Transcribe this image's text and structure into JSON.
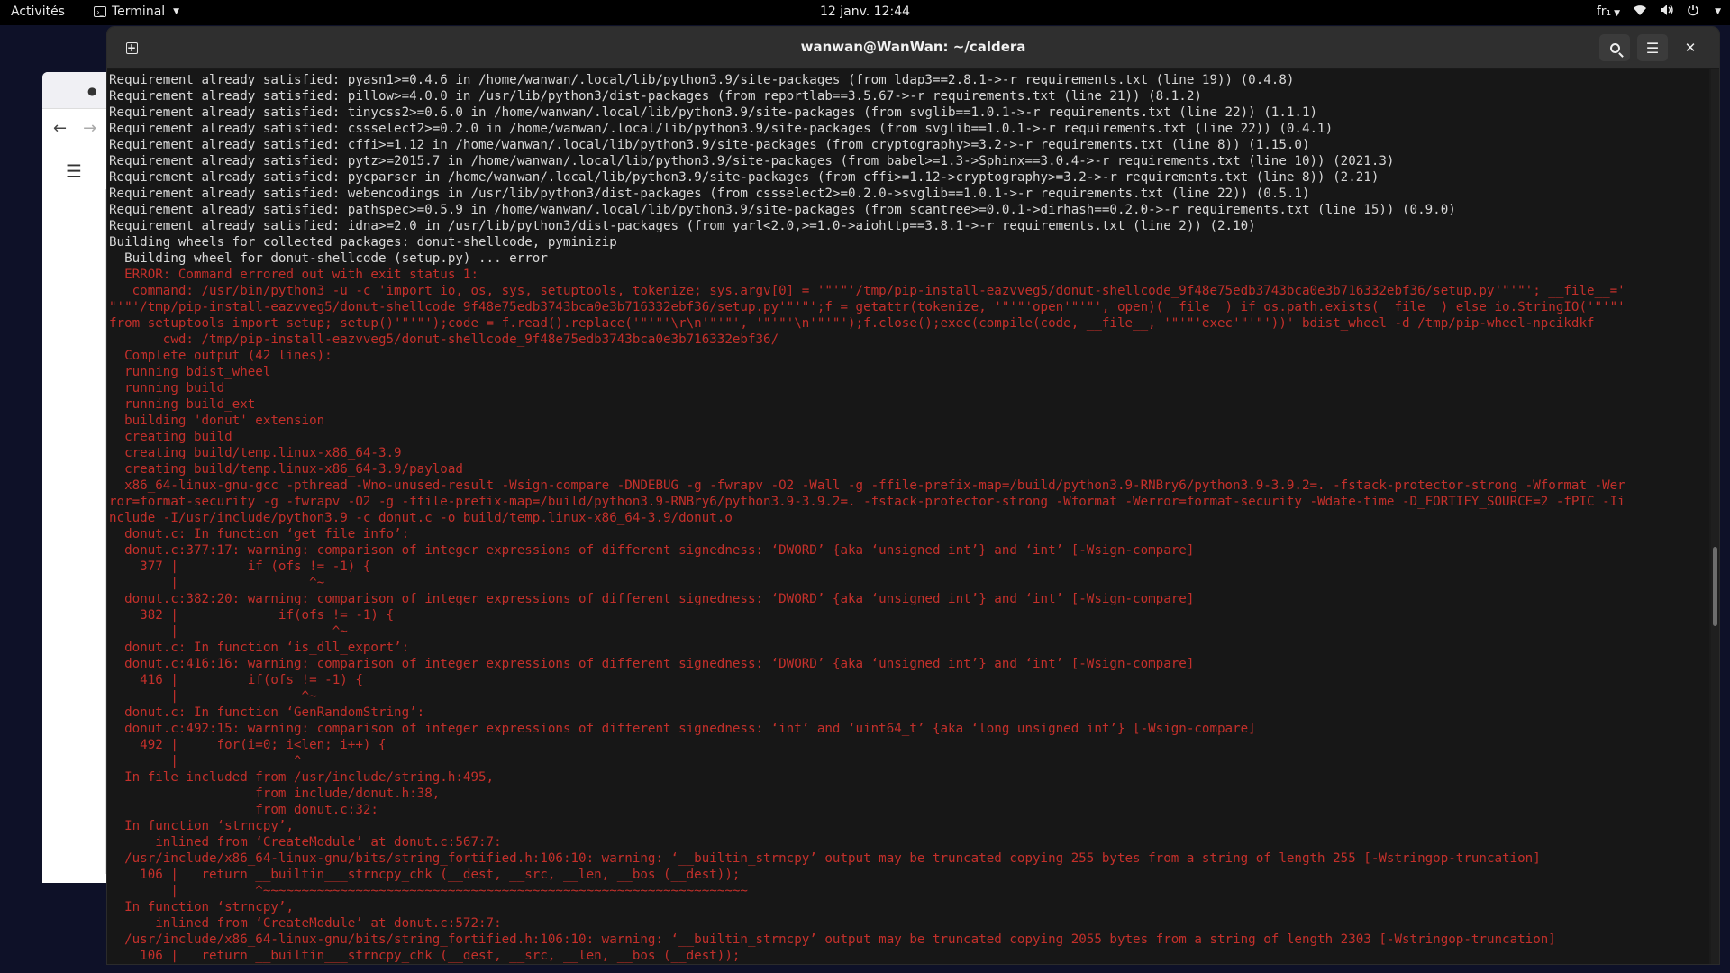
{
  "topbar": {
    "activities": "Activités",
    "app_name": "Terminal",
    "clock": "12 janv.  12:44",
    "keyboard_layout": "fr₁"
  },
  "terminal": {
    "title": "wanwan@WanWan: ~/caldera",
    "lines": [
      {
        "t": "Requirement already satisfied: pyasn1>=0.4.6 in /home/wanwan/.local/lib/python3.9/site-packages (from ldap3==2.8.1->-r requirements.txt (line 19)) (0.4.8)",
        "err": false
      },
      {
        "t": "Requirement already satisfied: pillow>=4.0.0 in /usr/lib/python3/dist-packages (from reportlab==3.5.67->-r requirements.txt (line 21)) (8.1.2)",
        "err": false
      },
      {
        "t": "Requirement already satisfied: tinycss2>=0.6.0 in /home/wanwan/.local/lib/python3.9/site-packages (from svglib==1.0.1->-r requirements.txt (line 22)) (1.1.1)",
        "err": false
      },
      {
        "t": "Requirement already satisfied: cssselect2>=0.2.0 in /home/wanwan/.local/lib/python3.9/site-packages (from svglib==1.0.1->-r requirements.txt (line 22)) (0.4.1)",
        "err": false
      },
      {
        "t": "Requirement already satisfied: cffi>=1.12 in /home/wanwan/.local/lib/python3.9/site-packages (from cryptography>=3.2->-r requirements.txt (line 8)) (1.15.0)",
        "err": false
      },
      {
        "t": "Requirement already satisfied: pytz>=2015.7 in /home/wanwan/.local/lib/python3.9/site-packages (from babel>=1.3->Sphinx==3.0.4->-r requirements.txt (line 10)) (2021.3)",
        "err": false
      },
      {
        "t": "Requirement already satisfied: pycparser in /home/wanwan/.local/lib/python3.9/site-packages (from cffi>=1.12->cryptography>=3.2->-r requirements.txt (line 8)) (2.21)",
        "err": false
      },
      {
        "t": "Requirement already satisfied: webencodings in /usr/lib/python3/dist-packages (from cssselect2>=0.2.0->svglib==1.0.1->-r requirements.txt (line 22)) (0.5.1)",
        "err": false
      },
      {
        "t": "Requirement already satisfied: pathspec>=0.5.9 in /home/wanwan/.local/lib/python3.9/site-packages (from scantree>=0.0.1->dirhash==0.2.0->-r requirements.txt (line 15)) (0.9.0)",
        "err": false
      },
      {
        "t": "Requirement already satisfied: idna>=2.0 in /usr/lib/python3/dist-packages (from yarl<2.0,>=1.0->aiohttp==3.8.1->-r requirements.txt (line 2)) (2.10)",
        "err": false
      },
      {
        "t": "Building wheels for collected packages: donut-shellcode, pyminizip",
        "err": false
      },
      {
        "t": "  Building wheel for donut-shellcode (setup.py) ... error",
        "err": false
      },
      {
        "t": "  ERROR: Command errored out with exit status 1:",
        "err": true
      },
      {
        "t": "   command: /usr/bin/python3 -u -c 'import io, os, sys, setuptools, tokenize; sys.argv[0] = '\"'\"'/tmp/pip-install-eazvveg5/donut-shellcode_9f48e75edb3743bca0e3b716332ebf36/setup.py'\"'\"'; __file__='",
        "err": true
      },
      {
        "t": "\"'\"'/tmp/pip-install-eazvveg5/donut-shellcode_9f48e75edb3743bca0e3b716332ebf36/setup.py'\"'\"';f = getattr(tokenize, '\"'\"'open'\"'\"', open)(__file__) if os.path.exists(__file__) else io.StringIO('\"'\"'",
        "err": true
      },
      {
        "t": "from setuptools import setup; setup()'\"'\"');code = f.read().replace('\"'\"'\\r\\n'\"'\"', '\"'\"'\\n'\"'\"');f.close();exec(compile(code, __file__, '\"'\"'exec'\"'\"'))' bdist_wheel -d /tmp/pip-wheel-npcikdkf",
        "err": true
      },
      {
        "t": "       cwd: /tmp/pip-install-eazvveg5/donut-shellcode_9f48e75edb3743bca0e3b716332ebf36/",
        "err": true
      },
      {
        "t": "  Complete output (42 lines):",
        "err": true
      },
      {
        "t": "  running bdist_wheel",
        "err": true
      },
      {
        "t": "  running build",
        "err": true
      },
      {
        "t": "  running build_ext",
        "err": true
      },
      {
        "t": "  building 'donut' extension",
        "err": true
      },
      {
        "t": "  creating build",
        "err": true
      },
      {
        "t": "  creating build/temp.linux-x86_64-3.9",
        "err": true
      },
      {
        "t": "  creating build/temp.linux-x86_64-3.9/payload",
        "err": true
      },
      {
        "t": "  x86_64-linux-gnu-gcc -pthread -Wno-unused-result -Wsign-compare -DNDEBUG -g -fwrapv -O2 -Wall -g -ffile-prefix-map=/build/python3.9-RNBry6/python3.9-3.9.2=. -fstack-protector-strong -Wformat -Wer",
        "err": true
      },
      {
        "t": "ror=format-security -g -fwrapv -O2 -g -ffile-prefix-map=/build/python3.9-RNBry6/python3.9-3.9.2=. -fstack-protector-strong -Wformat -Werror=format-security -Wdate-time -D_FORTIFY_SOURCE=2 -fPIC -Ii",
        "err": true
      },
      {
        "t": "nclude -I/usr/include/python3.9 -c donut.c -o build/temp.linux-x86_64-3.9/donut.o",
        "err": true
      },
      {
        "t": "  donut.c: In function ‘get_file_info’:",
        "err": true
      },
      {
        "t": "  donut.c:377:17: warning: comparison of integer expressions of different signedness: ‘DWORD’ {aka ‘unsigned int’} and ‘int’ [-Wsign-compare]",
        "err": true
      },
      {
        "t": "    377 |         if (ofs != -1) {",
        "err": true
      },
      {
        "t": "        |                 ^~",
        "err": true
      },
      {
        "t": "  donut.c:382:20: warning: comparison of integer expressions of different signedness: ‘DWORD’ {aka ‘unsigned int’} and ‘int’ [-Wsign-compare]",
        "err": true
      },
      {
        "t": "    382 |             if(ofs != -1) {",
        "err": true
      },
      {
        "t": "        |                    ^~",
        "err": true
      },
      {
        "t": "  donut.c: In function ‘is_dll_export’:",
        "err": true
      },
      {
        "t": "  donut.c:416:16: warning: comparison of integer expressions of different signedness: ‘DWORD’ {aka ‘unsigned int’} and ‘int’ [-Wsign-compare]",
        "err": true
      },
      {
        "t": "    416 |         if(ofs != -1) {",
        "err": true
      },
      {
        "t": "        |                ^~",
        "err": true
      },
      {
        "t": "  donut.c: In function ‘GenRandomString’:",
        "err": true
      },
      {
        "t": "  donut.c:492:15: warning: comparison of integer expressions of different signedness: ‘int’ and ‘uint64_t’ {aka ‘long unsigned int’} [-Wsign-compare]",
        "err": true
      },
      {
        "t": "    492 |     for(i=0; i<len; i++) {",
        "err": true
      },
      {
        "t": "        |               ^",
        "err": true
      },
      {
        "t": "  In file included from /usr/include/string.h:495,",
        "err": true
      },
      {
        "t": "                   from include/donut.h:38,",
        "err": true
      },
      {
        "t": "                   from donut.c:32:",
        "err": true
      },
      {
        "t": "  In function ‘strncpy’,",
        "err": true
      },
      {
        "t": "      inlined from ‘CreateModule’ at donut.c:567:7:",
        "err": true
      },
      {
        "t": "  /usr/include/x86_64-linux-gnu/bits/string_fortified.h:106:10: warning: ‘__builtin_strncpy’ output may be truncated copying 255 bytes from a string of length 255 [-Wstringop-truncation]",
        "err": true
      },
      {
        "t": "    106 |   return __builtin___strncpy_chk (__dest, __src, __len, __bos (__dest));",
        "err": true
      },
      {
        "t": "        |          ^~~~~~~~~~~~~~~~~~~~~~~~~~~~~~~~~~~~~~~~~~~~~~~~~~~~~~~~~~~~~~~~",
        "err": true
      },
      {
        "t": "  In function ‘strncpy’,",
        "err": true
      },
      {
        "t": "      inlined from ‘CreateModule’ at donut.c:572:7:",
        "err": true
      },
      {
        "t": "  /usr/include/x86_64-linux-gnu/bits/string_fortified.h:106:10: warning: ‘__builtin_strncpy’ output may be truncated copying 2055 bytes from a string of length 2303 [-Wstringop-truncation]",
        "err": true
      },
      {
        "t": "    106 |   return __builtin___strncpy_chk (__dest, __src, __len, __bos (__dest));",
        "err": true
      }
    ]
  }
}
